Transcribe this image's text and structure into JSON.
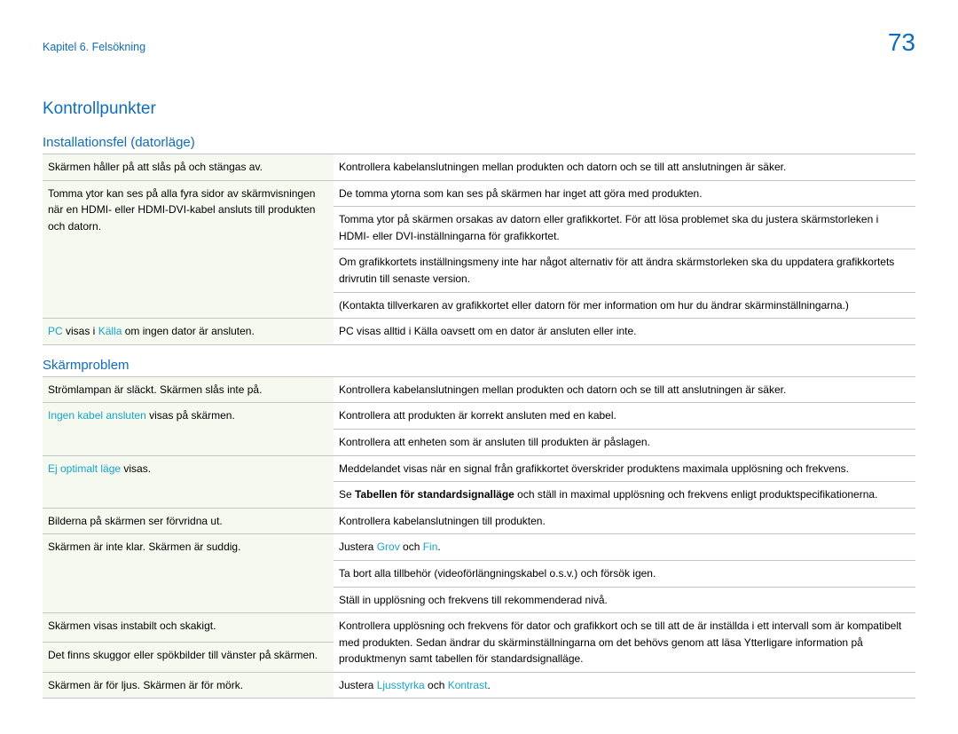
{
  "header": {
    "chapter": "Kapitel 6. Felsökning",
    "page_number": "73"
  },
  "section_title": "Kontrollpunkter",
  "section1": {
    "title": "Installationsfel (datorläge)",
    "rows": {
      "r1_left": "Skärmen håller på att slås på och stängas av.",
      "r1_right": "Kontrollera kabelanslutningen mellan produkten och datorn och se till att anslutningen är säker.",
      "r2_left": "Tomma ytor kan ses på alla fyra sidor av skärmvisningen när en HDMI- eller HDMI-DVI-kabel ansluts till produkten och datorn.",
      "r2_right_a": "De tomma ytorna som kan ses på skärmen har inget att göra med produkten.",
      "r2_right_b": "Tomma ytor på skärmen orsakas av datorn eller grafikkortet. För att lösa problemet ska du justera skärmstorleken i HDMI- eller DVI-inställningarna för grafikkortet.",
      "r2_right_c": "Om grafikkortets inställningsmeny inte har något alternativ för att ändra skärmstorleken ska du uppdatera grafikkortets drivrutin till senaste version.",
      "r2_right_d": "(Kontakta tillverkaren av grafikkortet eller datorn för mer information om hur du ändrar skärminställningarna.)",
      "r3_left_a": "PC",
      "r3_left_b": " visas i ",
      "r3_left_c": "Källa",
      "r3_left_d": " om ingen dator är ansluten.",
      "r3_right": "PC visas alltid i Källa oavsett om en dator är ansluten eller inte."
    }
  },
  "section2": {
    "title": "Skärmproblem",
    "rows": {
      "r1_left": "Strömlampan är släckt. Skärmen slås inte på.",
      "r1_right": "Kontrollera kabelanslutningen mellan produkten och datorn och se till att anslutningen är säker.",
      "r2_left_a": "Ingen kabel ansluten",
      "r2_left_b": " visas på skärmen.",
      "r2_right_a": "Kontrollera att produkten är korrekt ansluten med en kabel.",
      "r2_right_b": "Kontrollera att enheten som är ansluten till produkten är påslagen.",
      "r3_left_a": "Ej optimalt läge",
      "r3_left_b": " visas.",
      "r3_right_a": "Meddelandet visas när en signal från grafikkortet överskrider produktens maximala upplösning och frekvens.",
      "r3_right_b_pre": "Se ",
      "r3_right_b_bold": "Tabellen för standardsignalläge",
      "r3_right_b_post": " och ställ in maximal upplösning och frekvens enligt produktspecifikationerna.",
      "r4_left": "Bilderna på skärmen ser förvridna ut.",
      "r4_right": "Kontrollera kabelanslutningen till produkten.",
      "r5_left": "Skärmen är inte klar. Skärmen är suddig.",
      "r5_right_a_pre": "Justera ",
      "r5_right_a_link1": "Grov",
      "r5_right_a_mid": " och ",
      "r5_right_a_link2": "Fin",
      "r5_right_a_post": ".",
      "r5_right_b": "Ta bort alla tillbehör (videoförlängningskabel o.s.v.) och försök igen.",
      "r5_right_c": "Ställ in upplösning och frekvens till rekommenderad nivå.",
      "r6_left": "Skärmen visas instabilt och skakigt.",
      "r6_right": "Kontrollera upplösning och frekvens för dator och grafikkort och se till att de är inställda i ett intervall som är kompatibelt med produkten. Sedan ändrar du skärminställningarna om det behövs genom att läsa Ytterligare information på produktmenyn samt tabellen för standardsignalläge.",
      "r7_left": "Det finns skuggor eller spökbilder till vänster på skärmen.",
      "r8_left": "Skärmen är för ljus. Skärmen är för mörk.",
      "r8_right_pre": "Justera ",
      "r8_right_link1": "Ljusstyrka",
      "r8_right_mid": " och ",
      "r8_right_link2": "Kontrast",
      "r8_right_post": "."
    }
  }
}
